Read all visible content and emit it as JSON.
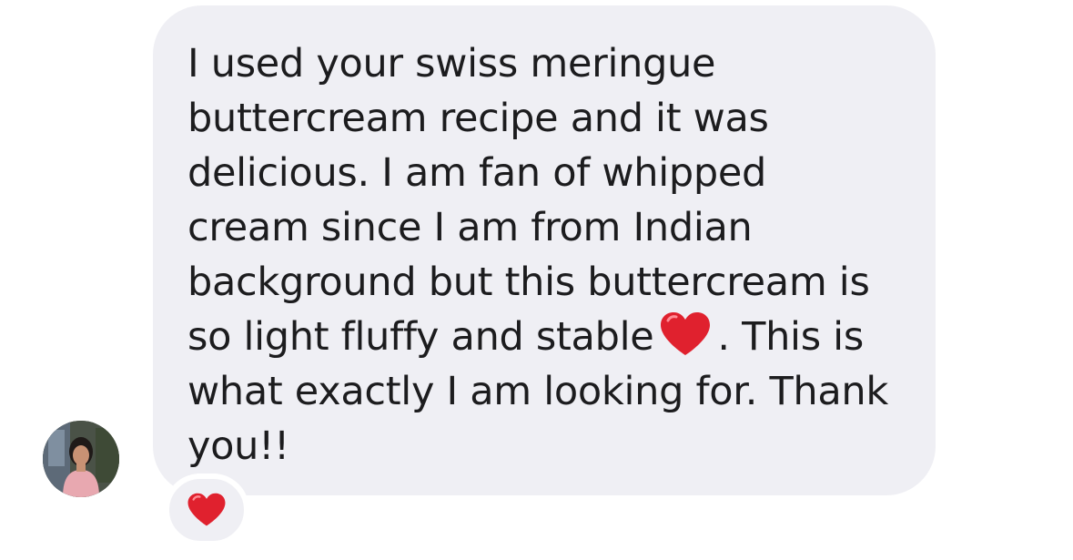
{
  "message": {
    "lines": [
      "I used your swiss meringue",
      "buttercream recipe and it was",
      "delicious. I am fan of whipped",
      "cream since I am from Indian",
      "background but this buttercream is",
      "so light fluffy and stable",
      ". This is",
      "what exactly I am looking for. Thank",
      "you!!"
    ],
    "inline_emoji": "red-heart"
  },
  "reaction": {
    "emoji": "red-heart"
  },
  "sender": {
    "avatar": "user-avatar-photo"
  },
  "colors": {
    "bubble": "#efeff4",
    "text": "#1c1c1e",
    "heart": "#e0212e"
  }
}
